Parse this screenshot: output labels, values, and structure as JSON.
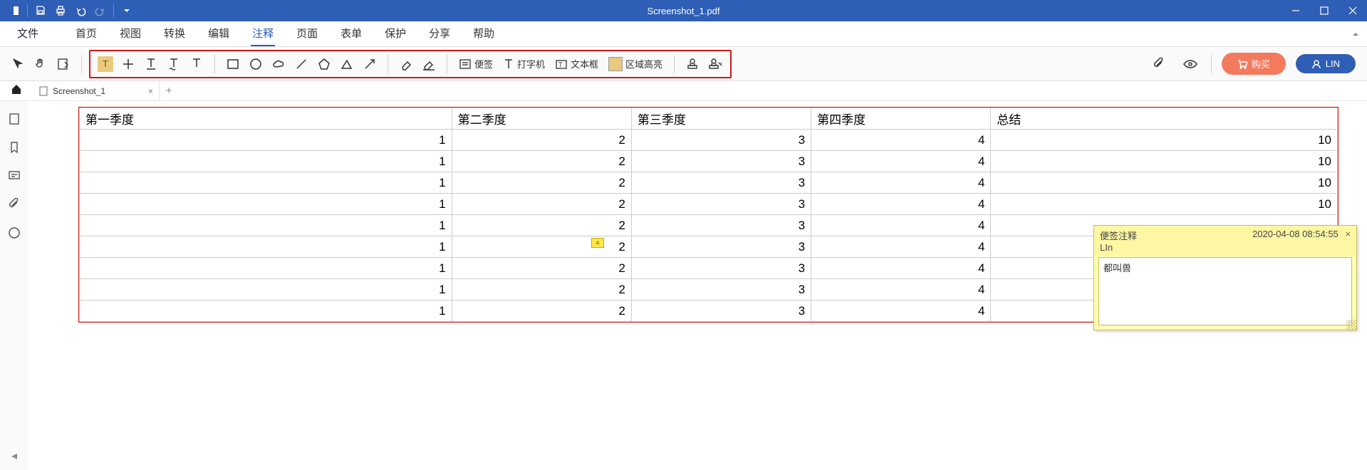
{
  "app": {
    "doc_title": "Screenshot_1.pdf"
  },
  "menu": {
    "file": "文件",
    "items": [
      "首页",
      "视图",
      "转换",
      "编辑",
      "注释",
      "页面",
      "表单",
      "保护",
      "分享",
      "帮助"
    ],
    "active_index": 4
  },
  "ribbon": {
    "tools": {
      "note_label": "便签",
      "typewriter_label": "打字机",
      "textbox_label": "文本框",
      "area_highlight_label": "区域高亮"
    },
    "buy_label": "购买",
    "user_label": "LIN"
  },
  "tabs": {
    "items": [
      {
        "label": "Screenshot_1"
      }
    ]
  },
  "chart_data": {
    "type": "table",
    "headers": [
      "第一季度",
      "第二季度",
      "第三季度",
      "第四季度",
      "总结"
    ],
    "rows": [
      [
        1,
        2,
        3,
        4,
        10
      ],
      [
        1,
        2,
        3,
        4,
        10
      ],
      [
        1,
        2,
        3,
        4,
        10
      ],
      [
        1,
        2,
        3,
        4,
        10
      ],
      [
        1,
        2,
        3,
        4,
        null
      ],
      [
        1,
        2,
        3,
        4,
        null
      ],
      [
        1,
        2,
        3,
        4,
        null
      ],
      [
        1,
        2,
        3,
        4,
        null
      ],
      [
        1,
        2,
        3,
        4,
        null
      ]
    ]
  },
  "sticky_note": {
    "title": "便签注释",
    "timestamp": "2020-04-08 08:54:55",
    "author": "LIn",
    "body": "都叫兽"
  }
}
